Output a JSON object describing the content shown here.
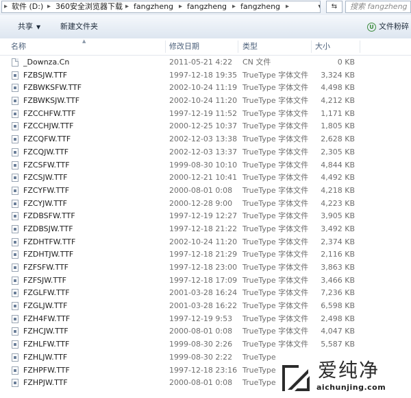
{
  "address": {
    "crumbs": [
      "软件 (D:)",
      "360安全浏览器下载",
      "fangzheng",
      "fangzheng",
      "fangzheng"
    ],
    "search_placeholder": "搜索 fangzheng"
  },
  "toolbar": {
    "share_label": "共享",
    "new_folder_label": "新建文件夹",
    "shred_label": "文件粉碎"
  },
  "columns": {
    "name": "名称",
    "modified": "修改日期",
    "type": "类型",
    "size": "大小"
  },
  "files": [
    {
      "name": "_Downza.Cn",
      "modified": "2011-05-21 4:22",
      "type": "CN 文件",
      "size": "0 KB",
      "icon": "blank"
    },
    {
      "name": "FZBSJW.TTF",
      "modified": "1997-12-18 19:35",
      "type": "TrueType 字体文件",
      "size": "3,324 KB",
      "icon": "ttf"
    },
    {
      "name": "FZBWKSFW.TTF",
      "modified": "2002-10-24 11:19",
      "type": "TrueType 字体文件",
      "size": "4,498 KB",
      "icon": "ttf"
    },
    {
      "name": "FZBWKSJW.TTF",
      "modified": "2002-10-24 11:20",
      "type": "TrueType 字体文件",
      "size": "4,212 KB",
      "icon": "ttf"
    },
    {
      "name": "FZCCHFW.TTF",
      "modified": "1997-12-19 11:52",
      "type": "TrueType 字体文件",
      "size": "1,171 KB",
      "icon": "ttf"
    },
    {
      "name": "FZCCHJW.TTF",
      "modified": "2000-12-25 10:37",
      "type": "TrueType 字体文件",
      "size": "1,805 KB",
      "icon": "ttf"
    },
    {
      "name": "FZCQFW.TTF",
      "modified": "2002-12-03 13:38",
      "type": "TrueType 字体文件",
      "size": "2,628 KB",
      "icon": "ttf"
    },
    {
      "name": "FZCQJW.TTF",
      "modified": "2002-12-03 13:37",
      "type": "TrueType 字体文件",
      "size": "2,305 KB",
      "icon": "ttf"
    },
    {
      "name": "FZCSFW.TTF",
      "modified": "1999-08-30 10:10",
      "type": "TrueType 字体文件",
      "size": "4,844 KB",
      "icon": "ttf"
    },
    {
      "name": "FZCSJW.TTF",
      "modified": "2000-12-21 10:41",
      "type": "TrueType 字体文件",
      "size": "4,492 KB",
      "icon": "ttf"
    },
    {
      "name": "FZCYFW.TTF",
      "modified": "2000-08-01 0:08",
      "type": "TrueType 字体文件",
      "size": "4,218 KB",
      "icon": "ttf"
    },
    {
      "name": "FZCYJW.TTF",
      "modified": "2000-12-28 9:00",
      "type": "TrueType 字体文件",
      "size": "4,223 KB",
      "icon": "ttf"
    },
    {
      "name": "FZDBSFW.TTF",
      "modified": "1997-12-19 12:27",
      "type": "TrueType 字体文件",
      "size": "3,905 KB",
      "icon": "ttf"
    },
    {
      "name": "FZDBSJW.TTF",
      "modified": "1997-12-18 21:22",
      "type": "TrueType 字体文件",
      "size": "3,492 KB",
      "icon": "ttf"
    },
    {
      "name": "FZDHTFW.TTF",
      "modified": "2002-10-24 11:20",
      "type": "TrueType 字体文件",
      "size": "2,374 KB",
      "icon": "ttf"
    },
    {
      "name": "FZDHTJW.TTF",
      "modified": "1997-12-18 21:29",
      "type": "TrueType 字体文件",
      "size": "2,116 KB",
      "icon": "ttf"
    },
    {
      "name": "FZFSFW.TTF",
      "modified": "1997-12-18 23:00",
      "type": "TrueType 字体文件",
      "size": "3,863 KB",
      "icon": "ttf"
    },
    {
      "name": "FZFSJW.TTF",
      "modified": "1997-12-18 17:09",
      "type": "TrueType 字体文件",
      "size": "3,466 KB",
      "icon": "ttf"
    },
    {
      "name": "FZGLFW.TTF",
      "modified": "2001-03-28 16:24",
      "type": "TrueType 字体文件",
      "size": "7,236 KB",
      "icon": "ttf"
    },
    {
      "name": "FZGLJW.TTF",
      "modified": "2001-03-28 16:22",
      "type": "TrueType 字体文件",
      "size": "6,598 KB",
      "icon": "ttf"
    },
    {
      "name": "FZH4FW.TTF",
      "modified": "1997-12-19 9:53",
      "type": "TrueType 字体文件",
      "size": "2,498 KB",
      "icon": "ttf"
    },
    {
      "name": "FZHCJW.TTF",
      "modified": "2000-08-01 0:08",
      "type": "TrueType 字体文件",
      "size": "4,047 KB",
      "icon": "ttf"
    },
    {
      "name": "FZHLFW.TTF",
      "modified": "1999-08-30 2:26",
      "type": "TrueType 字体文件",
      "size": "5,587 KB",
      "icon": "ttf"
    },
    {
      "name": "FZHLJW.TTF",
      "modified": "1999-08-30 2:22",
      "type": "TrueType",
      "size": "",
      "icon": "ttf"
    },
    {
      "name": "FZHPFW.TTF",
      "modified": "1997-12-18 23:16",
      "type": "TrueType",
      "size": "",
      "icon": "ttf"
    },
    {
      "name": "FZHPJW.TTF",
      "modified": "2000-08-01 0:08",
      "type": "TrueType",
      "size": "",
      "icon": "ttf"
    }
  ],
  "watermark": {
    "brand": "爱纯净",
    "url": "aichunjing.com"
  },
  "colors": {
    "toolbar_text": "#1e2b3a",
    "header_text": "#4c607a",
    "meta_text": "#6d6d6d",
    "shred_green": "#3a8a3a"
  }
}
